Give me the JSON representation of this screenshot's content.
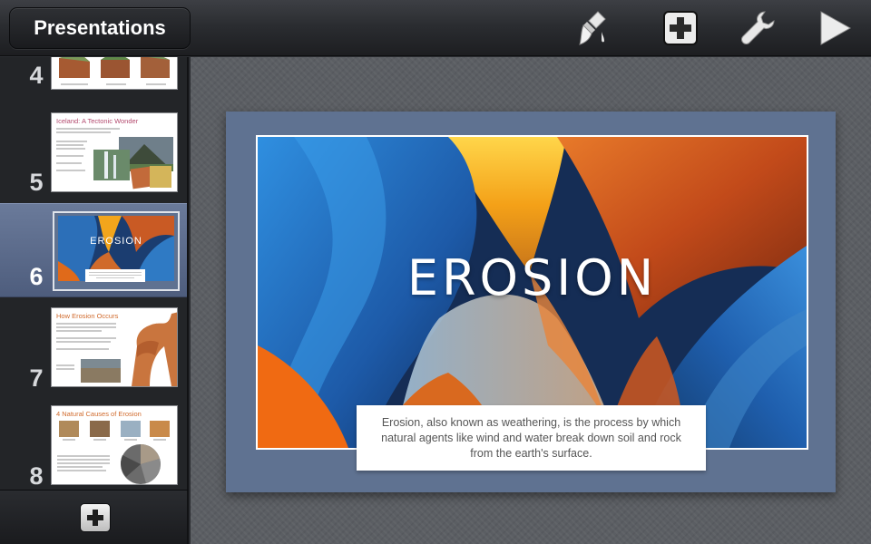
{
  "toolbar": {
    "presentations_label": "Presentations",
    "icons": [
      "paintbrush-icon",
      "add-icon",
      "wrench-icon",
      "play-icon"
    ]
  },
  "sidebar": {
    "slides": [
      {
        "number": "4",
        "title": ""
      },
      {
        "number": "5",
        "title": "Iceland: A Tectonic Wonder"
      },
      {
        "number": "6",
        "title": "EROSION",
        "selected": true
      },
      {
        "number": "7",
        "title": "How Erosion Occurs"
      },
      {
        "number": "8",
        "title": "4 Natural Causes of Erosion"
      }
    ]
  },
  "slide": {
    "title": "EROSION",
    "caption": "Erosion, also known as weathering, is the process by which natural agents like wind and water break down soil and rock from the earth's surface."
  },
  "colors": {
    "toolbar": "#2a2c30",
    "selection": "#5f6f8f",
    "slide_frame": "#5f7291",
    "accent_title": "#b34a6e"
  }
}
